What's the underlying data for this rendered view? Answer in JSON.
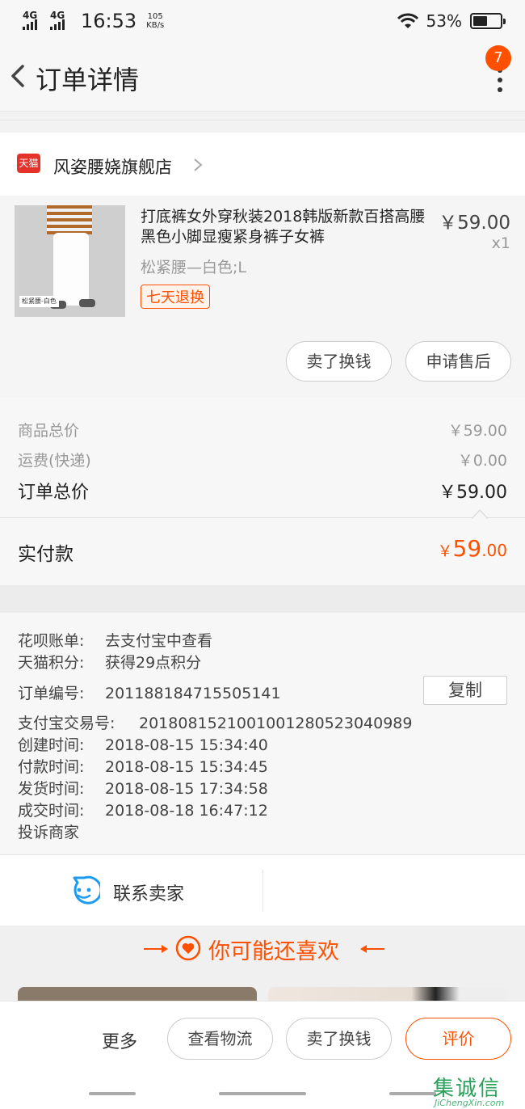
{
  "status_bar": {
    "network1": "4G",
    "network2": "4G",
    "time": "16:53",
    "speed_value": "105",
    "speed_unit": "KB/s",
    "battery_pct": "53%",
    "battery_level": 0.53
  },
  "header": {
    "title": "订单详情",
    "badge_count": "7"
  },
  "shop": {
    "logo_text": "天猫",
    "name": "风姿腰娆旗舰店"
  },
  "product": {
    "image_tag": "松紧腰-白色",
    "title": "打底裤女外穿秋装2018韩版新款百搭高腰黑色小脚显瘦紧身裤子女裤",
    "price": "￥59.00",
    "quantity": "x1",
    "sku": "松紧腰—白色;L",
    "service_tag": "七天退换",
    "buttons": {
      "sell": "卖了换钱",
      "after_sale": "申请售后"
    }
  },
  "totals": {
    "goods_label": "商品总价",
    "goods_value": "￥59.00",
    "shipping_label": "运费(快递)",
    "shipping_value": "￥0.00",
    "order_total_label": "订单总价",
    "order_total_value": "￥59.00",
    "paid_label": "实付款",
    "paid_currency": "￥",
    "paid_integer": "59",
    "paid_decimal": ".00"
  },
  "order_info": {
    "huabei_label": "花呗账单:",
    "huabei_value": "去支付宝中查看",
    "points_label": "天猫积分:",
    "points_value": "获得29点积分",
    "order_no_label": "订单编号:",
    "order_no_value": "201188184715505141",
    "copy_label": "复制",
    "alipay_label": "支付宝交易号:",
    "alipay_value": "2018081521001001280523040989",
    "created_label": "创建时间:",
    "created_value": "2018-08-15 15:34:40",
    "paid_time_label": "付款时间:",
    "paid_time_value": "2018-08-15 15:34:45",
    "shipped_label": "发货时间:",
    "shipped_value": "2018-08-15 17:34:58",
    "completed_label": "成交时间:",
    "completed_value": "2018-08-18 16:47:12",
    "complaint_label": "投诉商家"
  },
  "contact": {
    "label": "联系卖家"
  },
  "recommend": {
    "title": "你可能还喜欢"
  },
  "bottom_bar": {
    "more": "更多",
    "logistics": "查看物流",
    "sell": "卖了换钱",
    "rate": "评价"
  },
  "watermark": {
    "text": "集诚信",
    "sub": "JiChengXin.com"
  },
  "colors": {
    "accent": "#ff5000",
    "tmall_red": "#e4322b",
    "contact_blue": "#1d9bf0"
  }
}
